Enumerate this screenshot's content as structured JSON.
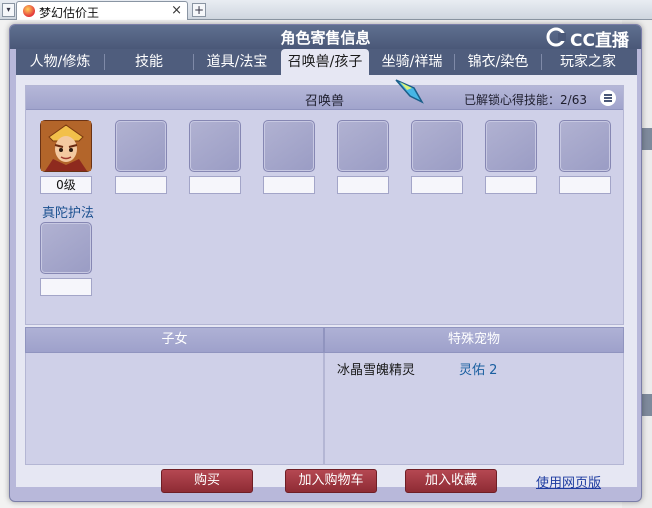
{
  "browser": {
    "tab_title": "梦幻估价王",
    "close_glyph": "×",
    "new_tab_glyph": "+",
    "scroll_glyph": "▾"
  },
  "dialog": {
    "title": "角色寄售信息",
    "logo_text": "CC直播"
  },
  "nav": {
    "tabs": [
      {
        "label": "人物/修炼"
      },
      {
        "label": "技能"
      },
      {
        "label": "道具/法宝"
      },
      {
        "label": "召唤兽/孩子"
      },
      {
        "label": "坐骑/祥瑞"
      },
      {
        "label": "锦衣/染色"
      },
      {
        "label": "玩家之家"
      }
    ],
    "active_index": 3
  },
  "summon": {
    "heading": "召唤兽",
    "skill_progress": "已解锁心得技能：2/63",
    "first_pet": {
      "level": "0级",
      "name": "真陀护法"
    }
  },
  "children": {
    "heading": "子女"
  },
  "special_pets": {
    "heading": "特殊宠物",
    "item_name": "冰晶雪魄精灵",
    "item_value": "灵佑 2"
  },
  "actions": {
    "buy": "购买",
    "add_cart": "加入购物车",
    "add_favorite": "加入收藏",
    "web_version": "使用网页版"
  },
  "colors": {
    "header": "#4a5878",
    "button": "#9f3740",
    "link": "#1d3ba0"
  }
}
